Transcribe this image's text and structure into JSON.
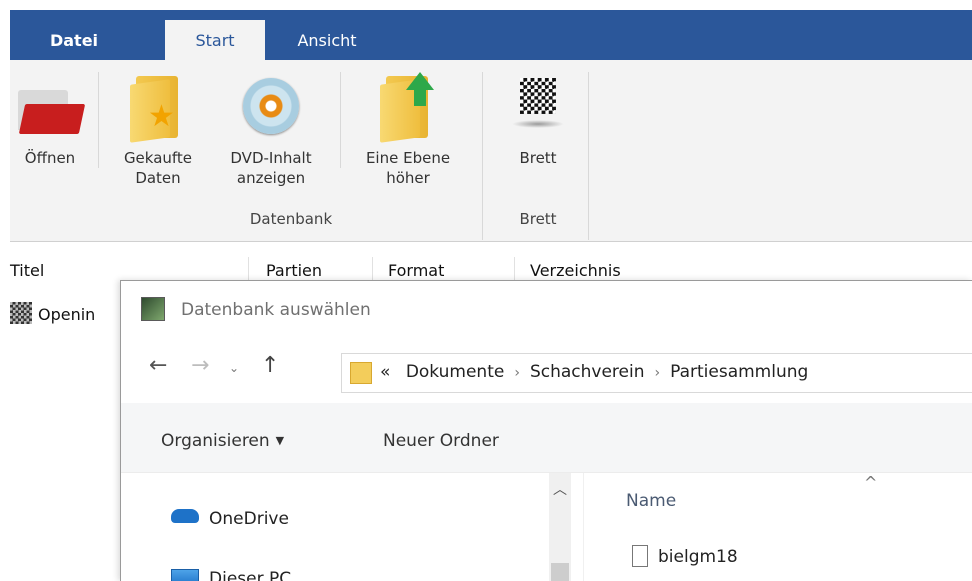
{
  "ribbon_tabs": {
    "datei": "Datei",
    "start": "Start",
    "ansicht": "Ansicht"
  },
  "ribbon": {
    "open": {
      "line1": "Öffnen",
      "icon": "red-folder-icon"
    },
    "purchased": {
      "line1": "Gekaufte",
      "line2": "Daten",
      "icon": "star-folder-icon"
    },
    "dvd": {
      "line1": "DVD-Inhalt",
      "line2": "anzeigen",
      "icon": "dvd-icon"
    },
    "level_up": {
      "line1": "Eine Ebene",
      "line2": "höher",
      "icon": "folder-up-icon"
    },
    "board": {
      "line1": "Brett",
      "icon": "chessboard-icon"
    },
    "group_datenbank": "Datenbank",
    "group_brett": "Brett"
  },
  "list": {
    "headers": [
      "Titel",
      "Partien",
      "Format",
      "Verzeichnis"
    ],
    "rows": [
      {
        "title": "Openin"
      }
    ]
  },
  "dialog": {
    "title": "Datenbank auswählen",
    "address": {
      "overflow": "«",
      "crumbs": [
        "Dokumente",
        "Schachverein",
        "Partiesammlung"
      ]
    },
    "commands": {
      "organize": "Organisieren",
      "new_folder": "Neuer Ordner"
    },
    "nav_items": [
      "OneDrive",
      "Dieser PC"
    ],
    "file_column": "Name",
    "files": [
      "bielgm18"
    ]
  },
  "colors": {
    "ribbon_blue": "#2b579a",
    "ribbon_bg": "#f3f3f3",
    "cmdbar_bg": "#f5f6f7"
  }
}
